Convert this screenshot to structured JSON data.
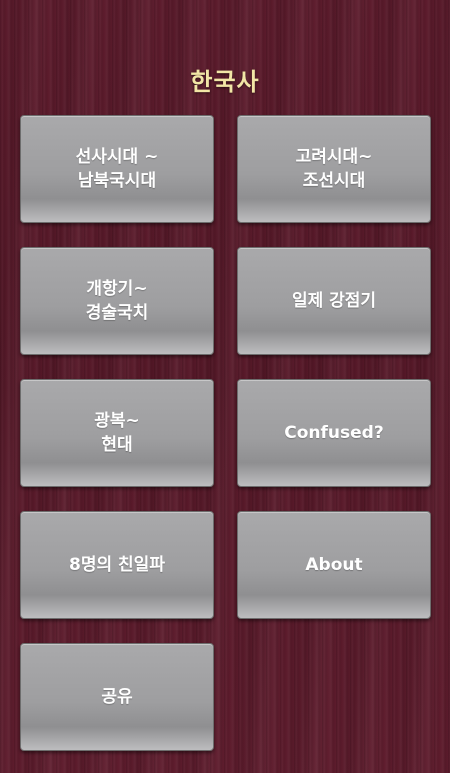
{
  "app": {
    "title": "한국사"
  },
  "menu": {
    "items": [
      {
        "label": "선사시대 ~\n남북국시대"
      },
      {
        "label": "고려시대~\n조선시대"
      },
      {
        "label": "개항기~\n경술국치"
      },
      {
        "label": "일제 강점기"
      },
      {
        "label": "광복~\n현대"
      },
      {
        "label": "Confused?"
      },
      {
        "label": "8명의 친일파"
      },
      {
        "label": "About"
      },
      {
        "label": "공유"
      }
    ]
  },
  "colors": {
    "background": "#5a1a2a",
    "title": "#f2e6a6",
    "tile": "#9e9ea0",
    "tile_text": "#ffffff"
  }
}
